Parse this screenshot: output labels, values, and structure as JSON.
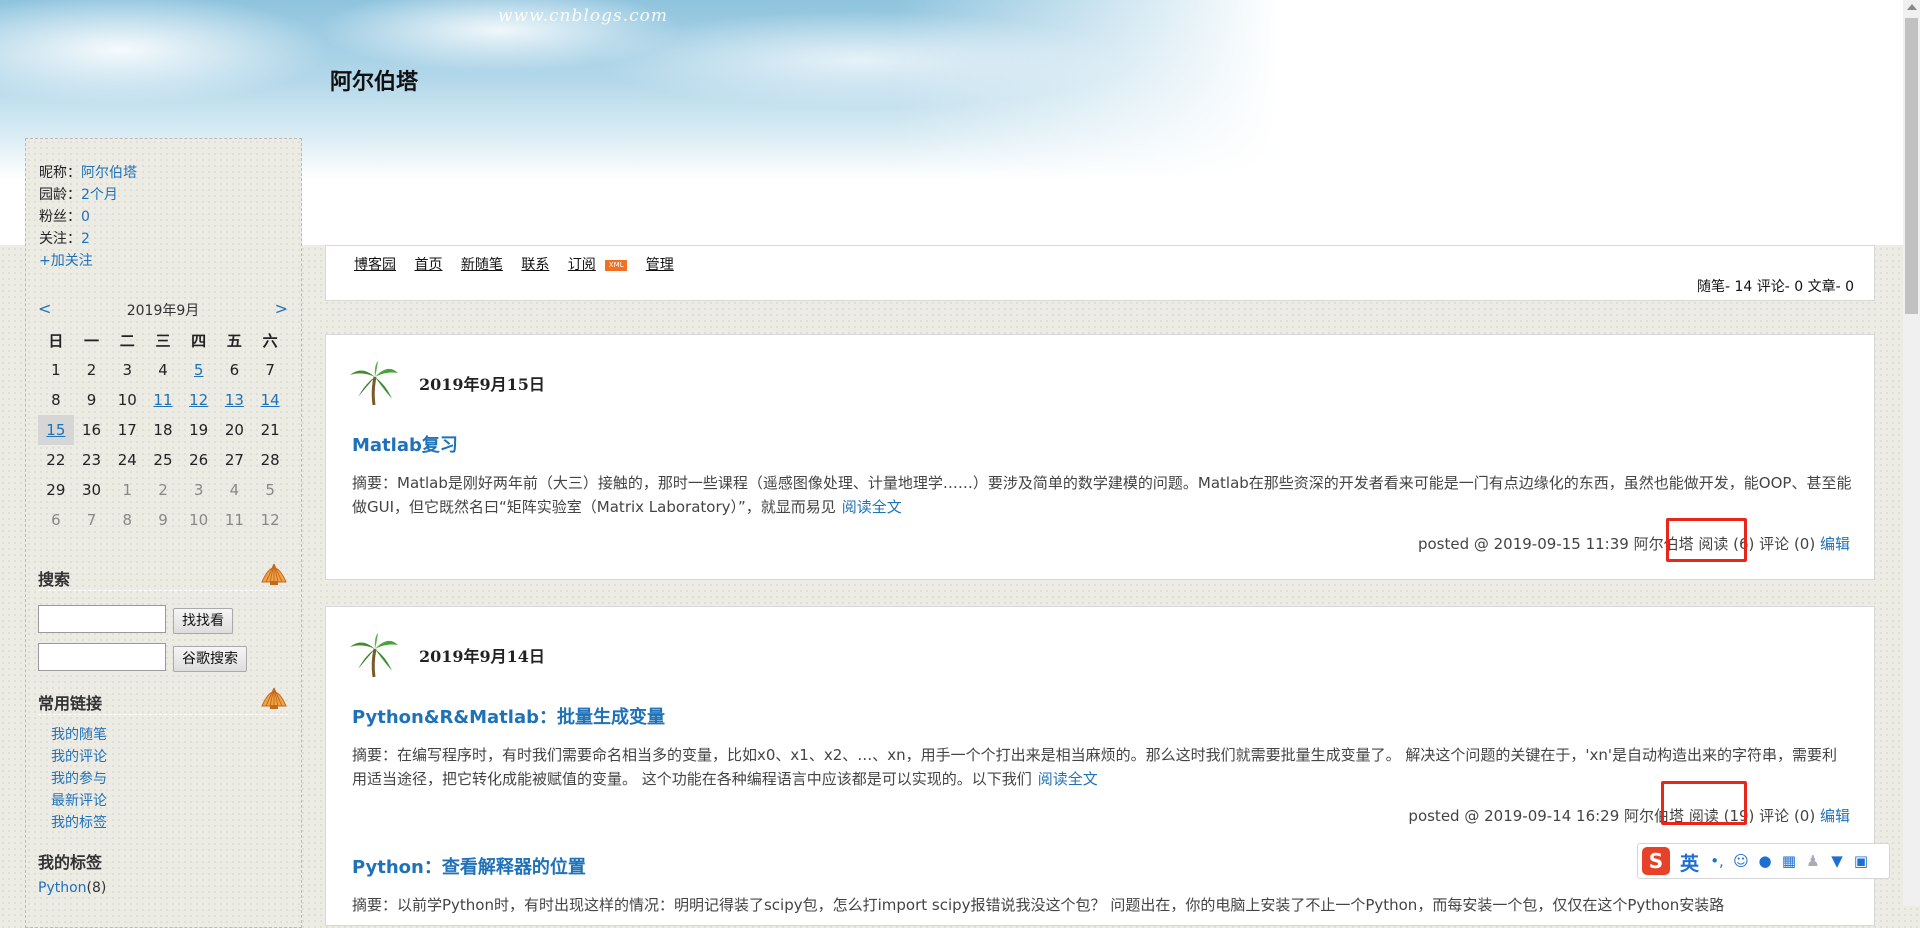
{
  "header": {
    "watermark": "www.cnblogs.com",
    "blog_title": "阿尔伯塔"
  },
  "profile": {
    "nickname_label": "昵称：",
    "nickname": "阿尔伯塔",
    "age_label": "园龄：",
    "age": "2个月",
    "fans_label": "粉丝：",
    "fans": "0",
    "follow_label": "关注：",
    "follow": "2",
    "add_follow": "+加关注"
  },
  "calendar": {
    "prev": "<",
    "next": ">",
    "title": "2019年9月",
    "weekdays": [
      "日",
      "一",
      "二",
      "三",
      "四",
      "五",
      "六"
    ],
    "weeks": [
      [
        {
          "d": "1"
        },
        {
          "d": "2"
        },
        {
          "d": "3"
        },
        {
          "d": "4"
        },
        {
          "d": "5",
          "link": true
        },
        {
          "d": "6"
        },
        {
          "d": "7"
        }
      ],
      [
        {
          "d": "8"
        },
        {
          "d": "9"
        },
        {
          "d": "10"
        },
        {
          "d": "11",
          "link": true
        },
        {
          "d": "12",
          "link": true
        },
        {
          "d": "13",
          "link": true
        },
        {
          "d": "14",
          "link": true
        }
      ],
      [
        {
          "d": "15",
          "today": true
        },
        {
          "d": "16"
        },
        {
          "d": "17"
        },
        {
          "d": "18"
        },
        {
          "d": "19"
        },
        {
          "d": "20"
        },
        {
          "d": "21"
        }
      ],
      [
        {
          "d": "22"
        },
        {
          "d": "23"
        },
        {
          "d": "24"
        },
        {
          "d": "25"
        },
        {
          "d": "26"
        },
        {
          "d": "27"
        },
        {
          "d": "28"
        }
      ],
      [
        {
          "d": "29"
        },
        {
          "d": "30"
        },
        {
          "d": "1",
          "other": true
        },
        {
          "d": "2",
          "other": true
        },
        {
          "d": "3",
          "other": true
        },
        {
          "d": "4",
          "other": true
        },
        {
          "d": "5",
          "other": true
        }
      ],
      [
        {
          "d": "6",
          "other": true
        },
        {
          "d": "7",
          "other": true
        },
        {
          "d": "8",
          "other": true
        },
        {
          "d": "9",
          "other": true
        },
        {
          "d": "10",
          "other": true
        },
        {
          "d": "11",
          "other": true
        },
        {
          "d": "12",
          "other": true
        }
      ]
    ]
  },
  "search": {
    "heading": "搜索",
    "btn_site": "找找看",
    "btn_google": "谷歌搜索"
  },
  "links": {
    "heading": "常用链接",
    "items": [
      "我的随笔",
      "我的评论",
      "我的参与",
      "最新评论",
      "我的标签"
    ]
  },
  "tags": {
    "heading": "我的标签",
    "first": "Python",
    "first_count": "(8)"
  },
  "nav": {
    "items": [
      "博客园",
      "首页",
      "新随笔",
      "联系",
      "订阅",
      "管理"
    ],
    "rss_badge": "XML",
    "stats": "随笔- 14  评论- 0  文章- 0"
  },
  "days": [
    {
      "date": "2019年9月15日",
      "post": {
        "title": "Matlab复习",
        "summary": "摘要：Matlab是刚好两年前（大三）接触的，那时一些课程（遥感图像处理、计量地理学……）要涉及简单的数学建模的问题。Matlab在那些资深的开发者看来可能是一门有点边缘化的东西，虽然也能做开发，能OOP、甚至能做GUI，但它既然名曰“矩阵实验室（Matrix Laboratory）”，就显而易见",
        "more": "阅读全文",
        "posted": "posted @ 2019-09-15 11:39 阿尔伯塔",
        "read": "阅读 (6)",
        "comment": "评论 (0)",
        "edit": "编辑"
      }
    },
    {
      "date": "2019年9月14日",
      "post": {
        "title": "Python&R&Matlab：批量生成变量",
        "summary": "摘要：在编写程序时，有时我们需要命名相当多的变量，比如x0、x1、x2、…、xn，用手一个个打出来是相当麻烦的。那么这时我们就需要批量生成变量了。 解决这个问题的关键在于，'xn'是自动构造出来的字符串，需要利用适当途径，把它转化成能被赋值的变量。 这个功能在各种编程语言中应该都是可以实现的。以下我们",
        "more": "阅读全文",
        "posted": "posted @ 2019-09-14 16:29 阿尔伯塔",
        "read": "阅读 (19)",
        "comment": "评论 (0)",
        "edit": "编辑"
      },
      "post2": {
        "title": "Python：查看解释器的位置",
        "summary": "摘要：以前学Python时，有时出现这样的情况：明明记得装了scipy包，怎么打import scipy报错说我没这个包？ 问题出在，你的电脑上安装了不止一个Python，而每安装一个包，仅仅在这个Python安装路"
      }
    }
  ],
  "ime": {
    "logo": "S",
    "lang": "英"
  },
  "colors": {
    "link": "#1f72b8",
    "highlight": "#e8261a",
    "ime_logo": "#e8412a"
  }
}
